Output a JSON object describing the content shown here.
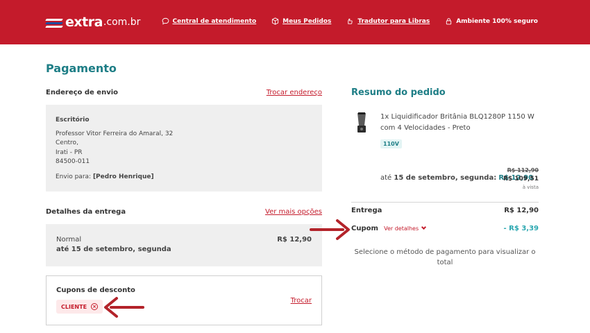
{
  "header": {
    "logo_text": "extra",
    "logo_suffix": ".com.br",
    "nav": [
      {
        "label": "Central de atendimento",
        "icon": "chat-icon"
      },
      {
        "label": "Meus Pedidos",
        "icon": "box-icon"
      },
      {
        "label": "Tradutor para Libras",
        "icon": "hands-icon"
      },
      {
        "label": "Ambiente 100% seguro",
        "icon": "lock-icon"
      }
    ]
  },
  "page": {
    "title": "Pagamento"
  },
  "address": {
    "section_title": "Endereço de envio",
    "change_link": "Trocar endereço",
    "name": "Escritório",
    "street": "Professor Vitor Ferreira do Amaral, 32",
    "district": "Centro,",
    "city": "Irati - PR",
    "zip": "84500-011",
    "to_label": "Envio para:",
    "to_name": "[Pedro Henrique]"
  },
  "delivery": {
    "section_title": "Detalhes da entrega",
    "more_link": "Ver mais opções",
    "type": "Normal",
    "date": "até 15 de setembro, segunda",
    "price": "R$ 12,90"
  },
  "coupons": {
    "title": "Cupons de desconto",
    "chip": "CLIENTE",
    "change_link": "Trocar"
  },
  "summary": {
    "title": "Resumo do pedido",
    "product_desc": "1x Liquidificador Britânia BLQ1280P 1150 W com 4 Velocidades - Preto",
    "voltage": "110V",
    "ship_prefix": "até",
    "ship_date": "15 de setembro, segunda:",
    "ship_price": "R$ 12,90",
    "old_price": "R$ 112,90",
    "new_price": "R$ 109,51",
    "price_note": "à vista",
    "delivery_label": "Entrega",
    "delivery_value": "R$ 12,90",
    "coupon_label": "Cupom",
    "details_link": "Ver detalhes",
    "coupon_value": "- R$ 3,39",
    "select_msg": "Selecione o método de pagamento para visualizar o total"
  },
  "colors": {
    "brand_red": "#c41b2b",
    "teal": "#1e7e86",
    "annotation_arrow": "#b3232a"
  }
}
